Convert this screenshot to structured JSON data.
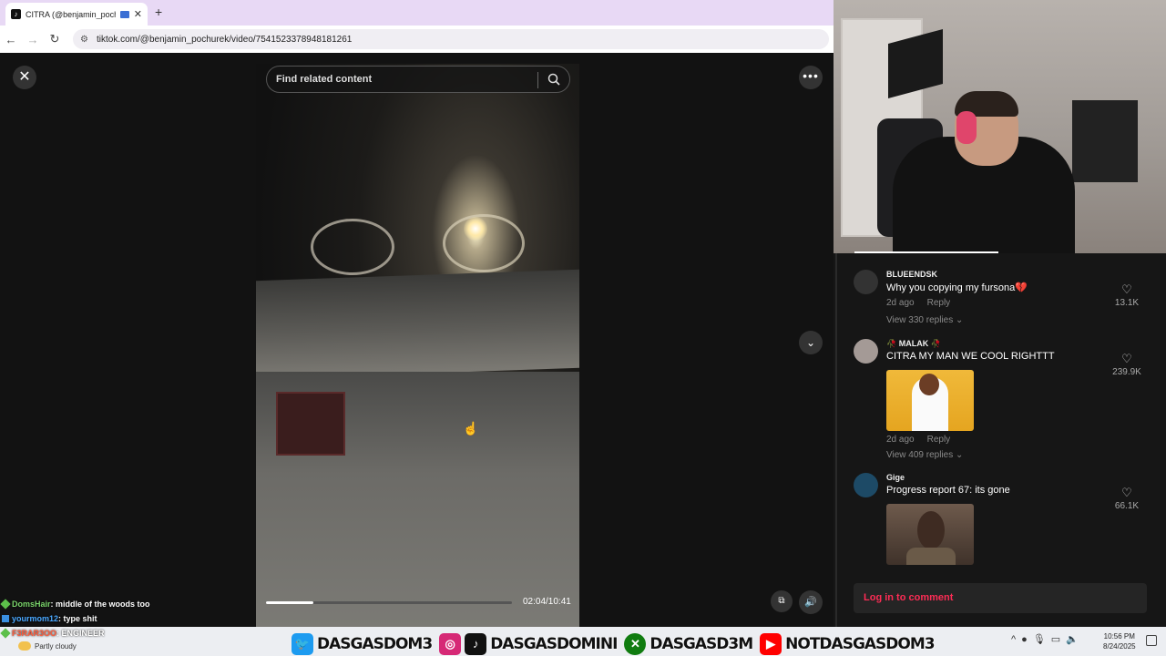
{
  "browser": {
    "tab_title": "CITRA (@benjamin_pochurek)",
    "tab_favicon": "tiktok-icon",
    "new_tab_symbol": "+",
    "url": "tiktok.com/@benjamin_pochurek/video/7541523378948181261"
  },
  "player": {
    "search_placeholder": "Find related content",
    "timecode": "02:04/10:41",
    "progress_fraction": 0.194,
    "accent": "#fe2c55"
  },
  "comments": [
    {
      "name": "BLUEENDSK",
      "text": "Why you copying my fursona💔",
      "time": "2d ago",
      "reply_label": "Reply",
      "likes": "13.1K",
      "view_replies": "View 330 replies ⌄",
      "avatar_color": "#333333"
    },
    {
      "name": "🥀 MALAK 🥀",
      "text": "CITRA MY MAN WE COOL RIGHTTT",
      "time": "2d ago",
      "reply_label": "Reply",
      "likes": "239.9K",
      "view_replies": "View 409 replies ⌄",
      "avatar_color": "#a49a96"
    },
    {
      "name": "Gige",
      "text": "Progress report 67: its gone",
      "likes": "66.1K",
      "avatar_color": "#1d4a66"
    }
  ],
  "login_label": "Log in to comment",
  "chat": [
    {
      "user": "DomsHair",
      "message": ": middle of the woods too"
    },
    {
      "user": "yourmom12",
      "message": ": type shit"
    },
    {
      "user": "F3RAR3OO",
      "message": ": ENGINEER"
    }
  ],
  "taskbar": {
    "weather": "Partly cloudy",
    "time": "10:56 PM",
    "date": "8/24/2025"
  },
  "banner": [
    {
      "icon": "twitter-icon",
      "glyph": "🐦",
      "color": "#1d9bf0",
      "handle": "DASGASDOM3"
    },
    {
      "icon": "instagram-icon",
      "glyph": "◎",
      "color": "#d62976",
      "handle": ""
    },
    {
      "icon": "tiktok-icon",
      "glyph": "♪",
      "color": "#111111",
      "handle": "DASGASDOMINI"
    },
    {
      "icon": "xbox-icon",
      "glyph": "✕",
      "color": "#107c10",
      "handle": "DASGASD3M"
    },
    {
      "icon": "youtube-icon",
      "glyph": "▶",
      "color": "#ff0000",
      "handle": "NOTDASGASDOM3"
    }
  ]
}
